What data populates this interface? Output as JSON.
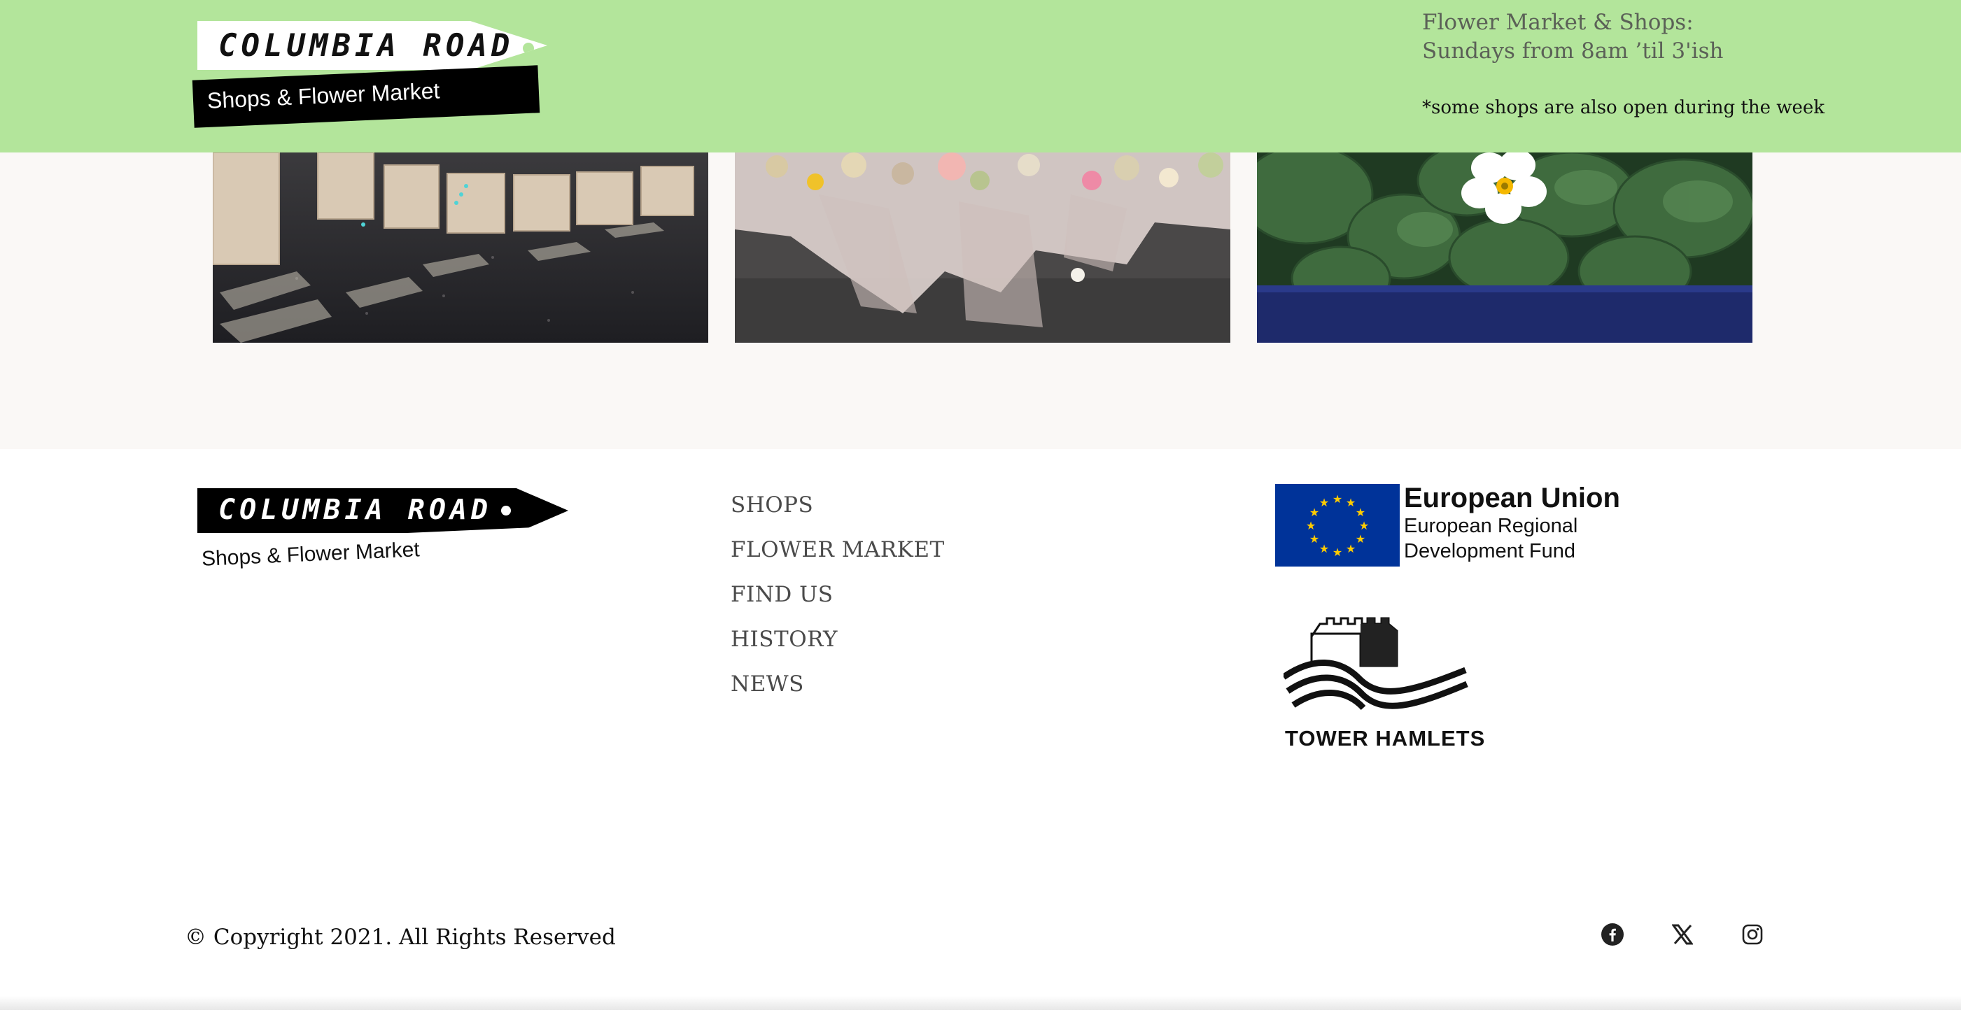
{
  "theme": {
    "accent": "#b3e59b",
    "eu_blue": "#003399",
    "eu_star": "#ffcc00"
  },
  "header": {
    "logo_name": "COLUMBIA ROAD",
    "logo_tagline": "Shops & Flower Market",
    "hours_line1": "Flower Market & Shops:",
    "hours_line2": "Sundays from 8am ’til 3'ish",
    "note": "*some shops are also open during the week"
  },
  "gallery": [
    "market-street-crates-photo",
    "dried-flower-bouquets-photo",
    "primrose-plants-photo"
  ],
  "footer": {
    "logo_name": "COLUMBIA ROAD",
    "logo_tagline": "Shops & Flower Market",
    "nav": [
      "SHOPS",
      "FLOWER MARKET",
      "FIND US",
      "HISTORY",
      "NEWS"
    ],
    "eu": {
      "title": "European Union",
      "line1": "European Regional",
      "line2": "Development Fund"
    },
    "council": "TOWER HAMLETS",
    "copyright": "© Copyright 2021. All Rights Reserved",
    "social_icons": [
      "facebook-icon",
      "x-twitter-icon",
      "instagram-icon"
    ]
  }
}
